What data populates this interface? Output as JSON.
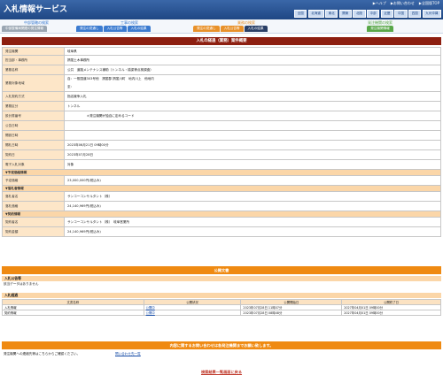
{
  "header": {
    "logo": "入札情報サービス",
    "links": [
      "ヘルプ",
      "お問い合わせ",
      "全国版TOP"
    ],
    "regions": [
      "全国",
      "北海道",
      "東北",
      "関東",
      "北陸",
      "中部",
      "近畿",
      "中国",
      "四国",
      "九州沖縄"
    ]
  },
  "nav": {
    "groups": [
      {
        "title": "中部管轄の検索",
        "tabs": [
          "中部整備局関連の発注情報"
        ]
      },
      {
        "title": "工事の検索",
        "tabs": [
          "発注の見通し",
          "入札公告等",
          "入札の結果"
        ]
      },
      {
        "title": "業務の検索",
        "tabs": [
          "発注の見通し",
          "入札公告等",
          "入札の結果"
        ]
      },
      {
        "title": "発注機関の検索",
        "tabs": [
          "発注機関情報"
        ]
      }
    ]
  },
  "title": "入札の経過（業務）案件概要",
  "detail": {
    "rows": [
      {
        "label": "発注機関",
        "value": "岐阜県"
      },
      {
        "label": "担当部・事務所",
        "value": "揖斐土木事務所"
      },
      {
        "label": "業務名称",
        "value": "公共　道路メンテナンス補助（トンネル・橋梁等点検調査）"
      },
      {
        "label": "業務対象地域",
        "value": "自：一般国道303号他　揖斐郡 揖斐川町　地内川上　他地内",
        "value2": "至："
      },
      {
        "label": "入札契約方式",
        "value": "指名競争入札"
      },
      {
        "label": "業務区分",
        "value": "トンネル"
      },
      {
        "label": "設計書番号",
        "value": "　　　　　　＊発注機関が独自に定めるコード"
      },
      {
        "label": "公告日時",
        "value": ""
      },
      {
        "label": "開設日時",
        "value": ""
      },
      {
        "label": "開札日時",
        "value": "2023年06月21日 09時00分"
      },
      {
        "label": "契約日",
        "value": "2023年07月28日"
      },
      {
        "label": "電子入札対象",
        "value": "対象"
      }
    ],
    "section_estimate": "▼予定価格情報",
    "estimate": {
      "label": "予定価格",
      "value": "23,000,000円(税込み)"
    },
    "section_winner": "▼落札者情報",
    "winner": [
      {
        "label": "落札者名",
        "value": "サンコーコンサルタント（株）"
      },
      {
        "label": "落札価格",
        "value": "24,140,969円(税込み)"
      }
    ],
    "section_contract": "▼契約情報",
    "contract": [
      {
        "label": "契約者名",
        "value": "サンコーコンサルタント（株）　岐阜営業所"
      },
      {
        "label": "契約金額",
        "value": "24,140,969円(税込み)"
      }
    ]
  },
  "public_docs": {
    "title": "公開文書",
    "notice_title": "入札公告等",
    "notice_empty": "該当データはありません",
    "progress_title": "入札経過",
    "headers": [
      "文書名称",
      "公開状況",
      "公開開始日",
      "公開終了日"
    ],
    "rows": [
      {
        "name": "入札情報",
        "status": "公開中",
        "start": "2023年07月28日 11時07分",
        "end": "2027年04月01日 09時00分"
      },
      {
        "name": "契約情報",
        "status": "公開中",
        "start": "2023年07月28日 08時48分",
        "end": "2027年04月01日 09時00分"
      }
    ]
  },
  "contact": {
    "title": "内容に関するお問い合わせは各発注機関までお願い致します。",
    "text": "発注機関への連絡先等はこちらからご確認ください。",
    "link": "問い合わせ先一覧"
  },
  "back_link": "検索結果一覧画面に戻る"
}
